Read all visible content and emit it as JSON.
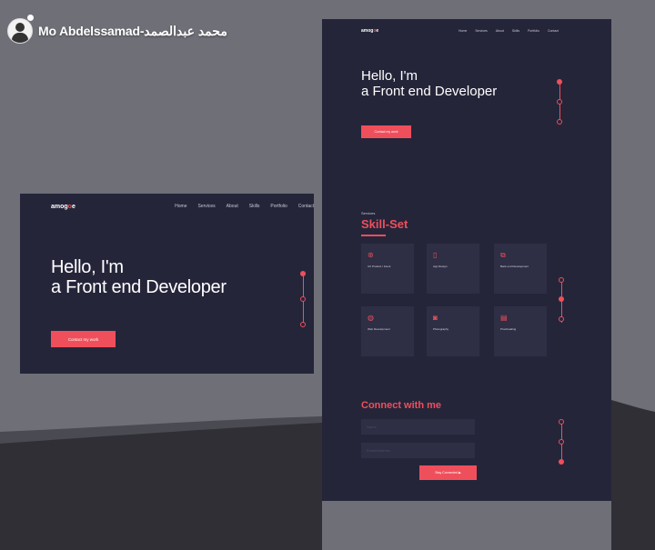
{
  "post": {
    "author": "Mo Abdelssamad-محمد عبدالصمد"
  },
  "site": {
    "logo_prefix": "amog",
    "logo_accent": "o",
    "logo_suffix": "e",
    "nav": [
      "Home",
      "Services",
      "About",
      "Skills",
      "Portfolio",
      "Contact"
    ],
    "hero_line1": "Hello, I'm",
    "hero_line2": "a Front end Developer",
    "cta_label": "Contact my work",
    "services_label": "Services",
    "skills_title": "Skill-Set",
    "skills": [
      {
        "icon": "github-icon",
        "glyph": "⊛",
        "title": "UX Product / Intent"
      },
      {
        "icon": "mobile-icon",
        "glyph": "▯",
        "title": "App Design"
      },
      {
        "icon": "layers-icon",
        "glyph": "⧉",
        "title": "Back end Development"
      },
      {
        "icon": "globe-icon",
        "glyph": "◍",
        "title": "Web Development"
      },
      {
        "icon": "camera-icon",
        "glyph": "◙",
        "title": "Photography"
      },
      {
        "icon": "docs-icon",
        "glyph": "▤",
        "title": "Proofreading"
      }
    ],
    "connect_title": "Connect with me",
    "field_name": "Name",
    "field_email": "Email/Address",
    "send_label": "Stay Connected ▶"
  },
  "colors": {
    "accent": "#ef4f5b",
    "panel": "#25253a",
    "backdrop": "#6f6f78"
  }
}
